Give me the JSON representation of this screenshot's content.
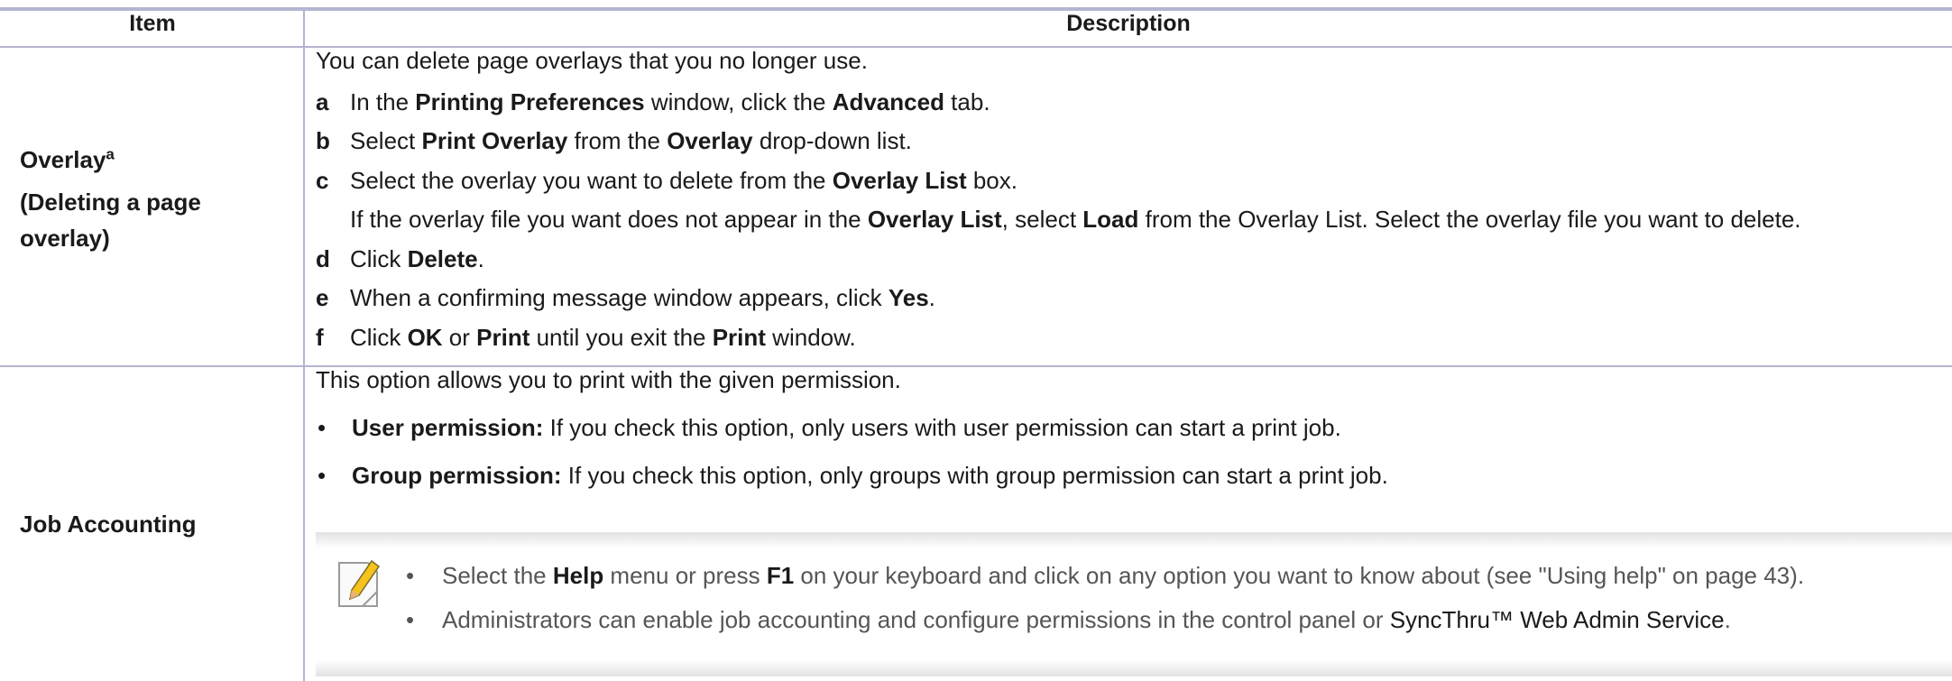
{
  "header": {
    "item": "Item",
    "description": "Description"
  },
  "rows": [
    {
      "item_title": "Overlay",
      "item_sup": "a",
      "item_sub": "(Deleting a page overlay)",
      "intro": "You can delete page overlays that you no longer use.",
      "steps": [
        {
          "letter": "a",
          "pre": "In the ",
          "b1": "Printing Preferences",
          "mid": " window, click the ",
          "b2": "Advanced",
          "post": " tab."
        },
        {
          "letter": "b",
          "pre": "Select ",
          "b1": "Print Overlay",
          "mid": " from the ",
          "b2": "Overlay",
          "post": " drop-down list."
        },
        {
          "letter": "c",
          "pre": "Select the overlay you want to delete from the ",
          "b1": "Overlay List",
          "mid": " box.",
          "b2": "",
          "post": ""
        },
        {
          "letter": "",
          "pre": "If the overlay file you want does not appear in the ",
          "b1": "Overlay List",
          "mid": ", select ",
          "b2": "Load",
          "post": " from the Overlay List. Select the overlay file you want to delete."
        },
        {
          "letter": "d",
          "pre": "Click ",
          "b1": "Delete",
          "mid": ".",
          "b2": "",
          "post": ""
        },
        {
          "letter": "e",
          "pre": "When a confirming message window appears, click ",
          "b1": "Yes",
          "mid": ".",
          "b2": "",
          "post": ""
        },
        {
          "letter": "f",
          "pre": "Click ",
          "b1": "OK",
          "mid": " or ",
          "b2": "Print",
          "post": " until you exit the ",
          "b3": "Print",
          "post2": " window."
        }
      ]
    },
    {
      "item_title": "Job Accounting",
      "intro": "This option allows you to print with the given permission.",
      "bullets": [
        {
          "bold": "User permission:",
          "text": " If you check this option, only users with user permission can start a print job."
        },
        {
          "bold": "Group permission:",
          "text": " If you check this option, only groups with group permission can start a print job."
        }
      ],
      "note": {
        "icon": "note-pencil-icon",
        "lines": [
          {
            "pre": "Select the ",
            "b1": "Help",
            "mid": " menu or press ",
            "b2": "F1",
            "post": " on your keyboard and click on any option you want to know about (see ",
            "link": "\"Using help\" on page 43",
            "end": ")."
          },
          {
            "pre": "Administrators can enable job accounting and configure permissions in the control panel or ",
            "dark": "SyncThru™ Web Admin Service",
            "end": "."
          }
        ]
      }
    }
  ]
}
